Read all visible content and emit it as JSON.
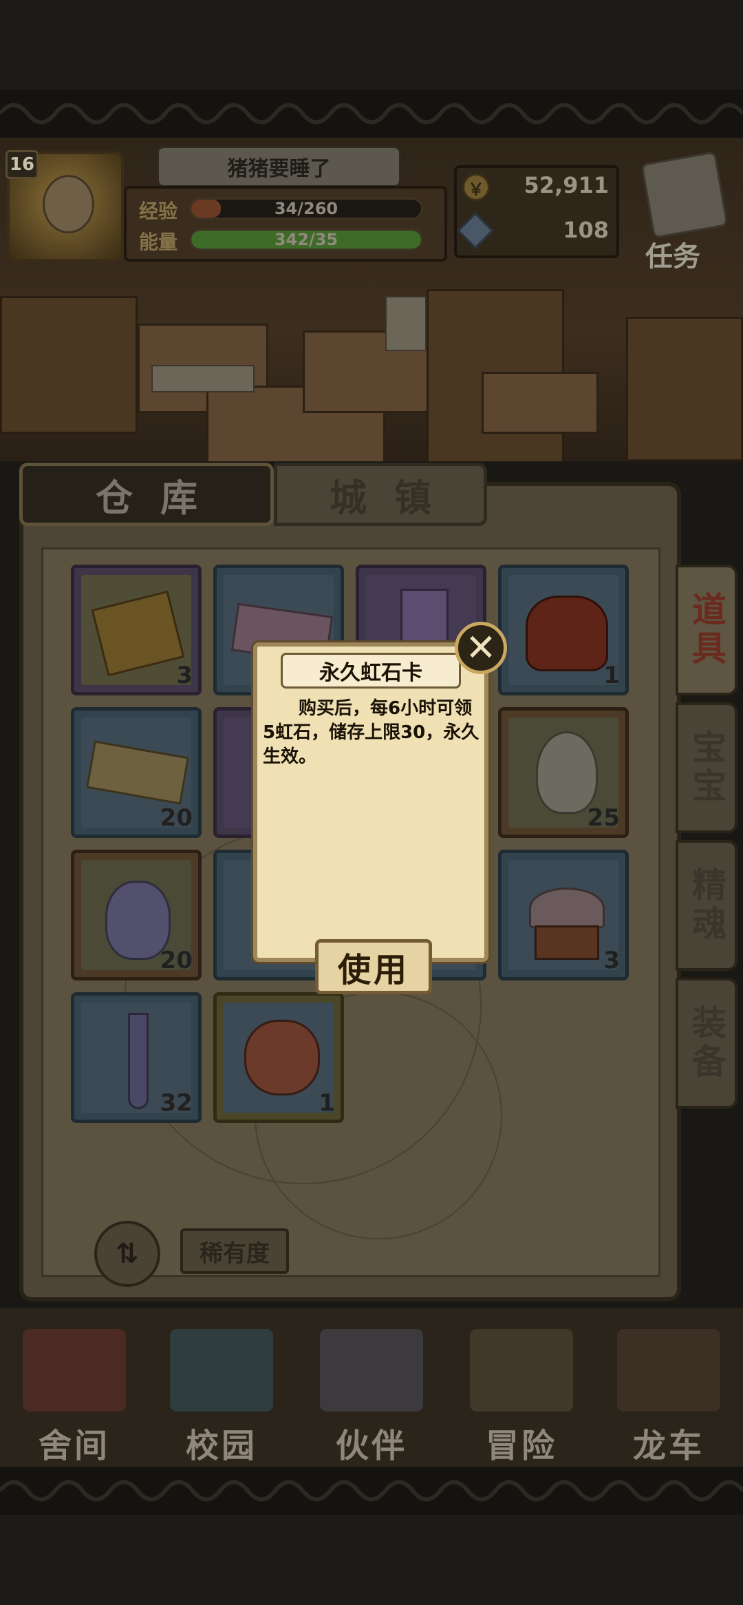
{
  "header": {
    "level": "16",
    "status_title": "猪猪要睡了",
    "exp": {
      "label": "经验",
      "value": "34/260",
      "fraction": 0.13
    },
    "energy": {
      "label": "能量",
      "value": "342/35",
      "fraction": 1.0
    },
    "gold": "52,911",
    "gems": "108",
    "task_label": "任务"
  },
  "tabs": {
    "warehouse": "仓库",
    "town": "城镇",
    "active": "warehouse"
  },
  "side_tabs": [
    "道具",
    "宝宝",
    "精魂",
    "装备"
  ],
  "items": [
    {
      "name": "golden-book-item",
      "count": "3",
      "rarity": "purple"
    },
    {
      "name": "pink-ticket-item",
      "count": "",
      "rarity": "blue"
    },
    {
      "name": "purple-crystal-item",
      "count": "",
      "rarity": "purple"
    },
    {
      "name": "red-sack-item",
      "count": "1",
      "rarity": "blue"
    },
    {
      "name": "winged-ticket-item",
      "count": "20",
      "rarity": "blue"
    },
    {
      "name": "hidden-item",
      "count": "",
      "rarity": "purple"
    },
    {
      "name": "hidden-item",
      "count": "",
      "rarity": "blue"
    },
    {
      "name": "winged-clock-egg-item",
      "count": "25",
      "rarity": "orange"
    },
    {
      "name": "potion-bottle-item",
      "count": "20",
      "rarity": "orange"
    },
    {
      "name": "hidden-item",
      "count": "",
      "rarity": "blue"
    },
    {
      "name": "hidden-item",
      "count": "",
      "rarity": "blue"
    },
    {
      "name": "cupcake-item",
      "count": "3",
      "rarity": "blue"
    },
    {
      "name": "test-tube-item",
      "count": "32",
      "rarity": "blue"
    },
    {
      "name": "gift-bag-item",
      "count": "1",
      "rarity": "gold"
    }
  ],
  "controls": {
    "sort_icon": "⇅",
    "rarity_label": "稀有度"
  },
  "popup": {
    "title": "永久虹石卡",
    "description": "购买后，每6小时可领5虹石，储存上限30，永久生效。",
    "use_label": "使用",
    "close_icon": "✕"
  },
  "nav": [
    "舍间",
    "校园",
    "伙伴",
    "冒险",
    "龙车"
  ]
}
